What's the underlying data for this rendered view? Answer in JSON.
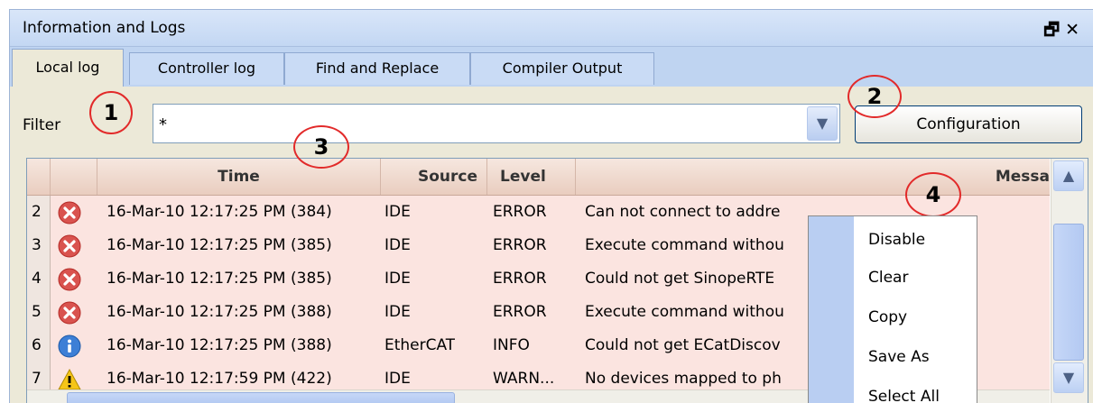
{
  "window": {
    "title": "Information and Logs",
    "controls": "🗗 ✕"
  },
  "tabs": [
    {
      "label": "Local log",
      "active": true
    },
    {
      "label": "Controller log",
      "active": false
    },
    {
      "label": "Find and Replace",
      "active": false
    },
    {
      "label": "Compiler Output",
      "active": false
    }
  ],
  "filter": {
    "label": "Filter",
    "value": "*",
    "configuration_button": "Configuration"
  },
  "grid": {
    "columns": [
      "Time",
      "Source",
      "Level",
      "Messa"
    ],
    "rows": [
      {
        "num": "2",
        "icon": "error-icon",
        "time": "16-Mar-10 12:17:25 PM (384)",
        "source": "IDE",
        "level": "ERROR",
        "message": "Can not connect to addre"
      },
      {
        "num": "3",
        "icon": "error-icon",
        "time": "16-Mar-10 12:17:25 PM (385)",
        "source": "IDE",
        "level": "ERROR",
        "message": "Execute command withou"
      },
      {
        "num": "4",
        "icon": "error-icon",
        "time": "16-Mar-10 12:17:25 PM (385)",
        "source": "IDE",
        "level": "ERROR",
        "message": "Could not get SinopeRTE"
      },
      {
        "num": "5",
        "icon": "error-icon",
        "time": "16-Mar-10 12:17:25 PM (388)",
        "source": "IDE",
        "level": "ERROR",
        "message": "Execute command withou"
      },
      {
        "num": "6",
        "icon": "info-icon",
        "time": "16-Mar-10 12:17:25 PM (388)",
        "source": "EtherCAT",
        "level": "INFO",
        "message": "Could not get ECatDiscov"
      },
      {
        "num": "7",
        "icon": "warning-icon",
        "time": "16-Mar-10 12:17:59 PM (422)",
        "source": "IDE",
        "level": "WARN...",
        "message": "No devices mapped to ph"
      }
    ]
  },
  "context_menu": {
    "items": [
      "Disable",
      "Clear",
      "Copy",
      "Save As",
      "Select All"
    ]
  },
  "callouts": [
    "1",
    "2",
    "3",
    "4"
  ],
  "colors": {
    "callout_red": "#e22a2a",
    "row_error_bg": "#fbe4e0",
    "tab_strip": "#bfd4f1"
  }
}
